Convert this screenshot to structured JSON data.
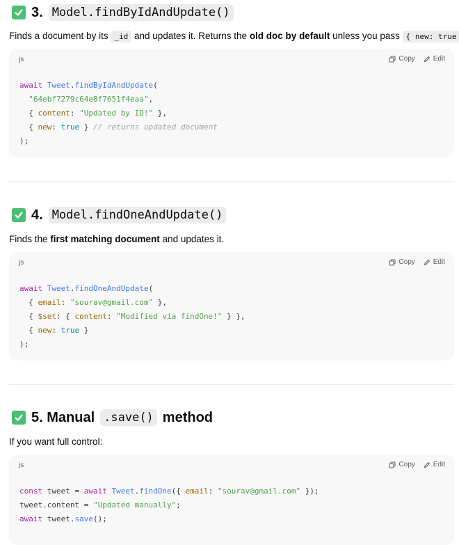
{
  "sections": [
    {
      "heading_num": "3.",
      "heading_code": "Model.findByIdAndUpdate()",
      "desc_pre": "Finds a document by its ",
      "desc_code1": "_id",
      "desc_mid": " and updates it. Returns the ",
      "desc_bold": "old doc by default",
      "desc_post": " unless you pass ",
      "desc_code2": "{ new: true }",
      "desc_end": ".",
      "lang": "js",
      "copy": "Copy",
      "edit": "Edit"
    },
    {
      "heading_num": "4.",
      "heading_code": "Model.findOneAndUpdate()",
      "desc_pre": "Finds the ",
      "desc_bold": "first matching document",
      "desc_post": " and updates it.",
      "lang": "js",
      "copy": "Copy",
      "edit": "Edit"
    },
    {
      "heading_num": "5. Manual",
      "heading_code": ".save()",
      "heading_post": "method",
      "desc": "If you want full control:",
      "lang": "js",
      "copy": "Copy",
      "edit": "Edit"
    }
  ],
  "code": {
    "await": "await",
    "const": "const",
    "Tweet": "Tweet",
    "findByIdAndUpdate": "findByIdAndUpdate",
    "findOneAndUpdate": "findOneAndUpdate",
    "findOne": "findOne",
    "save": "save",
    "id_str": "\"64ebf7279c64e8f7651f4eaa\"",
    "content": "content",
    "updated_str": "\"Updated by ID!\"",
    "new": "new",
    "true": "true",
    "comment": "// returns updated document",
    "email": "email",
    "email_str": "\"sourav@gmail.com\"",
    "set": "$set",
    "modified_str": "\"Modified via findOne!\"",
    "tweet": "tweet",
    "manual_str": "\"Updated manually\""
  },
  "colors": {
    "check_green": "#4bbf73",
    "codeblock_bg": "#f8f8f8",
    "inline_code_bg": "#ececec"
  }
}
